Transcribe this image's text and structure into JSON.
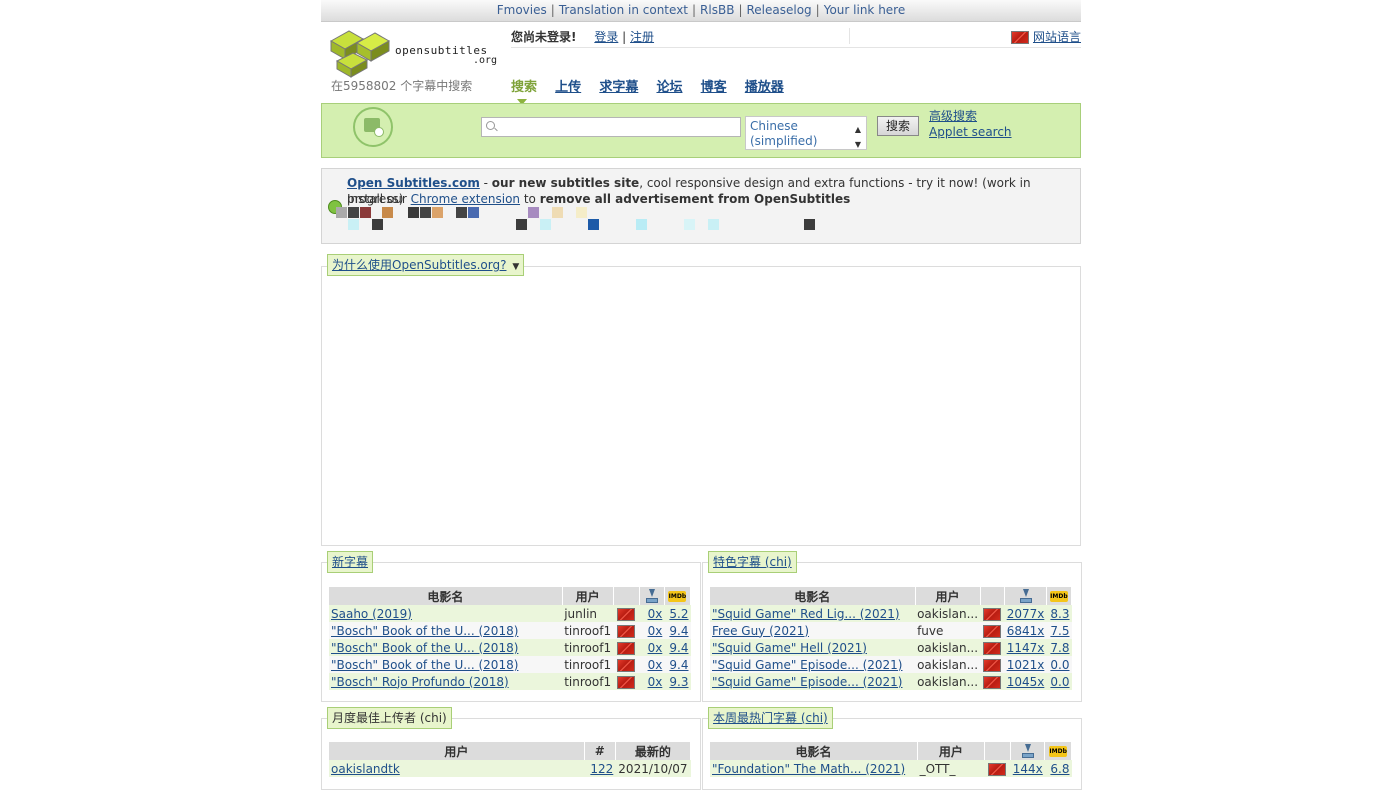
{
  "topbar": {
    "links": [
      "Fmovies",
      "Translation in context",
      "RlsBB",
      "Releaselog",
      "Your link here"
    ],
    "separator": "|"
  },
  "header": {
    "logo_text": "opensubtitles",
    "logo_domain": ".org",
    "subtitle_count": "在5958802 个字幕中搜索",
    "not_logged_in": "您尚未登录!",
    "login": "登录",
    "register": "注册",
    "pipe": "|",
    "site_language": "网站语言"
  },
  "nav": {
    "items": [
      "搜索",
      "上传",
      "求字幕",
      "论坛",
      "博客",
      "播放器"
    ],
    "active_index": 0
  },
  "search": {
    "placeholder": "",
    "language_line1": "Chinese",
    "language_line2": "(simplified)",
    "button": "搜索",
    "advanced": "高级搜索",
    "applet": "Applet search"
  },
  "notice": {
    "link1": "Open Subtitles.com",
    "text1a": " - ",
    "text1b": "our new subtitles site",
    "text1c": ", cool responsive design and extra functions - try it now! (work in progress)",
    "text2a": "Install our ",
    "link2": "Chrome extension",
    "text2b": " to ",
    "text2c": "remove all advertisement from OpenSubtitles"
  },
  "why": {
    "title": "为什么使用OpenSubtitles.org?"
  },
  "new_subs": {
    "title": "新字幕",
    "headers": [
      "电影名",
      "用户",
      "",
      "",
      ""
    ],
    "rows": [
      {
        "title": "Saaho (2019)",
        "user": "junlin",
        "dl": "0x",
        "rating": "5.2"
      },
      {
        "title": "\"Bosch\" Book of the U... (2018)",
        "user": "tinroof1",
        "dl": "0x",
        "rating": "9.4"
      },
      {
        "title": "\"Bosch\" Book of the U... (2018)",
        "user": "tinroof1",
        "dl": "0x",
        "rating": "9.4"
      },
      {
        "title": "\"Bosch\" Book of the U... (2018)",
        "user": "tinroof1",
        "dl": "0x",
        "rating": "9.4"
      },
      {
        "title": "\"Bosch\" Rojo Profundo (2018)",
        "user": "tinroof1",
        "dl": "0x",
        "rating": "9.3"
      }
    ]
  },
  "featured": {
    "title": "特色字幕 (chi)",
    "headers": [
      "电影名",
      "用户",
      "",
      "",
      ""
    ],
    "rows": [
      {
        "title": "\"Squid Game\" Red Lig... (2021)",
        "user": "oakislan...",
        "dl": "2077x",
        "rating": "8.3"
      },
      {
        "title": "Free Guy (2021)",
        "user": "fuve",
        "dl": "6841x",
        "rating": "7.5"
      },
      {
        "title": "\"Squid Game\" Hell (2021)",
        "user": "oakislan...",
        "dl": "1147x",
        "rating": "7.8"
      },
      {
        "title": "\"Squid Game\" Episode... (2021)",
        "user": "oakislan...",
        "dl": "1021x",
        "rating": "0.0"
      },
      {
        "title": "\"Squid Game\" Episode... (2021)",
        "user": "oakislan...",
        "dl": "1045x",
        "rating": "0.0"
      }
    ]
  },
  "uploaders": {
    "title": "月度最佳上传者 (chi)",
    "headers": [
      "用户",
      "#",
      "最新的"
    ],
    "rows": [
      {
        "user": "oakislandtk",
        "count": "122",
        "latest": "2021/10/07"
      }
    ]
  },
  "popular": {
    "title": "本周最热门字幕 (chi)",
    "headers": [
      "电影名",
      "用户",
      "",
      "",
      ""
    ],
    "rows": [
      {
        "title": "\"Foundation\" The Math... (2021)",
        "user": "_OTT_",
        "dl": "144x",
        "rating": "6.8"
      }
    ]
  },
  "icons": {
    "imdb_text": "IMDb"
  }
}
